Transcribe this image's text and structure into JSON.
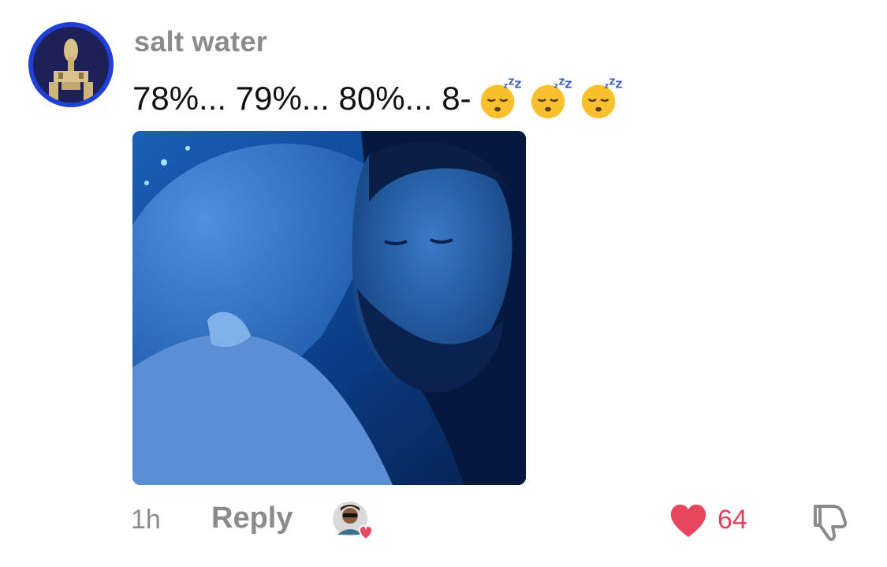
{
  "comment": {
    "username": "salt water",
    "text": "78%... 79%... 80%... 8-",
    "emojis": [
      "sleeping-face-icon",
      "sleeping-face-icon",
      "sleeping-face-icon"
    ],
    "time": "1h",
    "reply_label": "Reply",
    "like_count": "64"
  },
  "colors": {
    "avatar_ring": "#1f3fd6",
    "username": "#8b8b8b",
    "like": "#e0405e",
    "media_tint": "#0a2a66"
  }
}
